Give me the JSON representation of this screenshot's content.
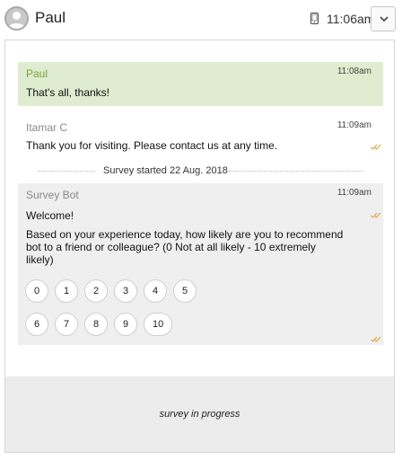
{
  "header": {
    "contact_name": "Paul",
    "time": "11:06am",
    "icons": [
      "user-avatar-icon",
      "mobile-phone-icon",
      "chevron-down-icon"
    ]
  },
  "messages": [
    {
      "sender": "Paul",
      "time": "11:08am",
      "text": "That's all, thanks!",
      "sender_color": "#7aa23a",
      "background": "#dfeccf"
    },
    {
      "sender": "Itamar C",
      "time": "11:09am",
      "text": "Thank you for visiting. Please contact us at any time.",
      "status_icon": "double-check-icon"
    }
  ],
  "divider": {
    "label": "Survey started 22 Aug. 2018"
  },
  "survey": {
    "sender": "Survey Bot",
    "time": "11:09am",
    "greeting": "Welcome!",
    "question_line1": "Based on your experience today, how likely are you to recommend",
    "question_line2": "bot to a friend or colleague? (0 Not at all likely - 10 extremely",
    "question_line3": "likely)",
    "scores_row1": [
      "0",
      "1",
      "2",
      "3",
      "4",
      "5"
    ],
    "scores_row2": [
      "6",
      "7",
      "8",
      "9",
      "10"
    ],
    "status_icon": "double-check-icon"
  },
  "footer": {
    "status": "survey in progress"
  },
  "colors": {
    "accent_green": "#7aa23a",
    "check_color": "#e2a43a"
  }
}
